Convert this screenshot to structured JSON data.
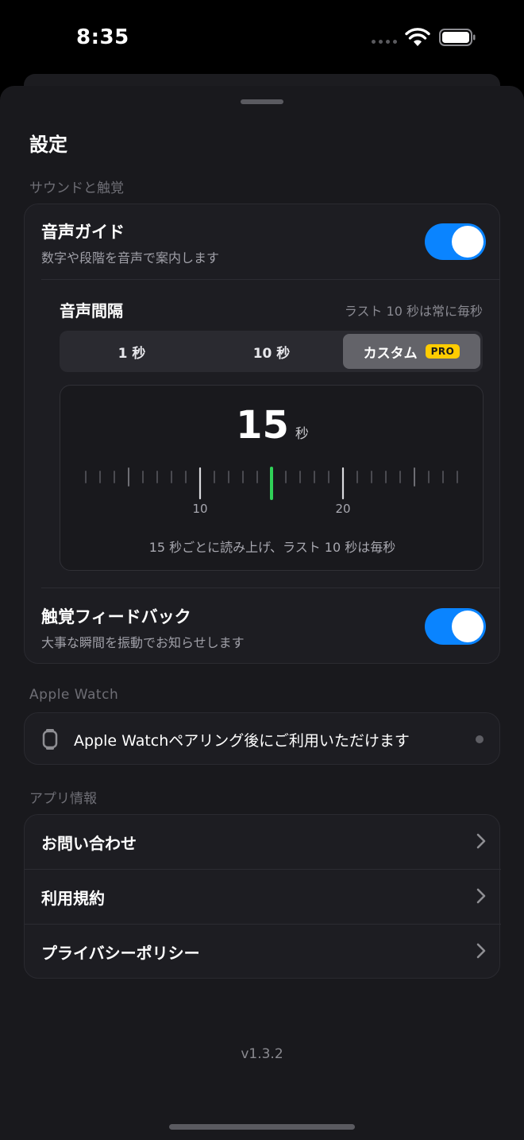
{
  "status": {
    "time": "8:35"
  },
  "page": {
    "title": "設定"
  },
  "sections": {
    "sound": "サウンドと触覚",
    "watch": "Apple Watch",
    "app": "アプリ情報"
  },
  "voice_guide": {
    "title": "音声ガイド",
    "subtitle": "数字や段階を音声で案内します",
    "enabled": true
  },
  "interval": {
    "title": "音声間隔",
    "note": "ラスト 10 秒は常に毎秒",
    "options": [
      "1 秒",
      "10 秒",
      "カスタム"
    ],
    "selected": "カスタム",
    "pro_badge": "PRO",
    "value": "15",
    "unit": "秒",
    "ruler_labels": [
      "10",
      "20"
    ],
    "ruler_min": 2,
    "ruler_max": 28,
    "caption": "15 秒ごとに読み上げ、ラスト 10 秒は毎秒"
  },
  "haptics": {
    "title": "触覚フィードバック",
    "subtitle": "大事な瞬間を振動でお知らせします",
    "enabled": true
  },
  "watch": {
    "text": "Apple Watchペアリング後にご利用いただけます"
  },
  "links": [
    "お問い合わせ",
    "利用規約",
    "プライバシーポリシー"
  ],
  "version": "v1.3.2",
  "colors": {
    "accent": "#0a84ff",
    "pro": "#ffcc00",
    "indicator": "#30d158"
  }
}
